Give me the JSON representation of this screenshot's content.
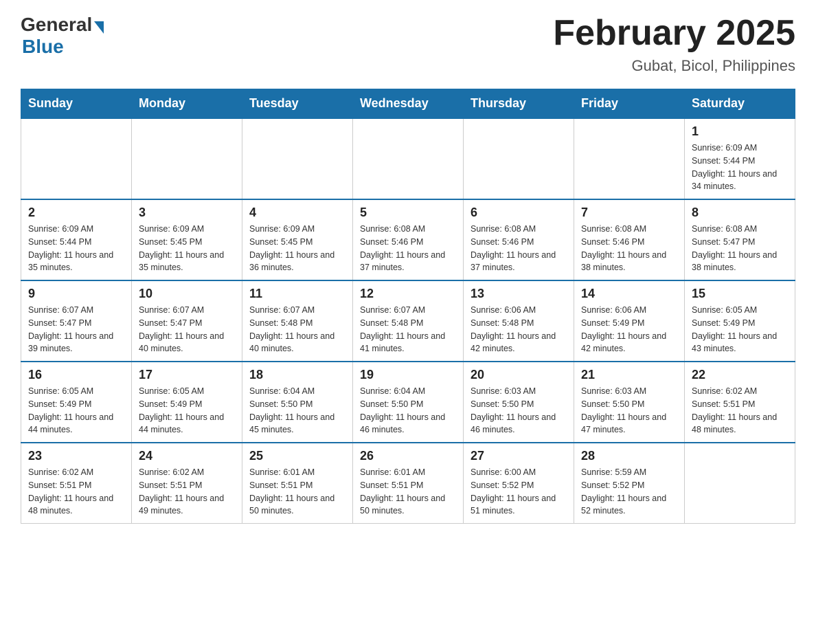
{
  "header": {
    "logo_general": "General",
    "logo_blue": "Blue",
    "main_title": "February 2025",
    "subtitle": "Gubat, Bicol, Philippines"
  },
  "days_of_week": [
    "Sunday",
    "Monday",
    "Tuesday",
    "Wednesday",
    "Thursday",
    "Friday",
    "Saturday"
  ],
  "weeks": [
    [
      {
        "day": "",
        "info": ""
      },
      {
        "day": "",
        "info": ""
      },
      {
        "day": "",
        "info": ""
      },
      {
        "day": "",
        "info": ""
      },
      {
        "day": "",
        "info": ""
      },
      {
        "day": "",
        "info": ""
      },
      {
        "day": "1",
        "info": "Sunrise: 6:09 AM\nSunset: 5:44 PM\nDaylight: 11 hours and 34 minutes."
      }
    ],
    [
      {
        "day": "2",
        "info": "Sunrise: 6:09 AM\nSunset: 5:44 PM\nDaylight: 11 hours and 35 minutes."
      },
      {
        "day": "3",
        "info": "Sunrise: 6:09 AM\nSunset: 5:45 PM\nDaylight: 11 hours and 35 minutes."
      },
      {
        "day": "4",
        "info": "Sunrise: 6:09 AM\nSunset: 5:45 PM\nDaylight: 11 hours and 36 minutes."
      },
      {
        "day": "5",
        "info": "Sunrise: 6:08 AM\nSunset: 5:46 PM\nDaylight: 11 hours and 37 minutes."
      },
      {
        "day": "6",
        "info": "Sunrise: 6:08 AM\nSunset: 5:46 PM\nDaylight: 11 hours and 37 minutes."
      },
      {
        "day": "7",
        "info": "Sunrise: 6:08 AM\nSunset: 5:46 PM\nDaylight: 11 hours and 38 minutes."
      },
      {
        "day": "8",
        "info": "Sunrise: 6:08 AM\nSunset: 5:47 PM\nDaylight: 11 hours and 38 minutes."
      }
    ],
    [
      {
        "day": "9",
        "info": "Sunrise: 6:07 AM\nSunset: 5:47 PM\nDaylight: 11 hours and 39 minutes."
      },
      {
        "day": "10",
        "info": "Sunrise: 6:07 AM\nSunset: 5:47 PM\nDaylight: 11 hours and 40 minutes."
      },
      {
        "day": "11",
        "info": "Sunrise: 6:07 AM\nSunset: 5:48 PM\nDaylight: 11 hours and 40 minutes."
      },
      {
        "day": "12",
        "info": "Sunrise: 6:07 AM\nSunset: 5:48 PM\nDaylight: 11 hours and 41 minutes."
      },
      {
        "day": "13",
        "info": "Sunrise: 6:06 AM\nSunset: 5:48 PM\nDaylight: 11 hours and 42 minutes."
      },
      {
        "day": "14",
        "info": "Sunrise: 6:06 AM\nSunset: 5:49 PM\nDaylight: 11 hours and 42 minutes."
      },
      {
        "day": "15",
        "info": "Sunrise: 6:05 AM\nSunset: 5:49 PM\nDaylight: 11 hours and 43 minutes."
      }
    ],
    [
      {
        "day": "16",
        "info": "Sunrise: 6:05 AM\nSunset: 5:49 PM\nDaylight: 11 hours and 44 minutes."
      },
      {
        "day": "17",
        "info": "Sunrise: 6:05 AM\nSunset: 5:49 PM\nDaylight: 11 hours and 44 minutes."
      },
      {
        "day": "18",
        "info": "Sunrise: 6:04 AM\nSunset: 5:50 PM\nDaylight: 11 hours and 45 minutes."
      },
      {
        "day": "19",
        "info": "Sunrise: 6:04 AM\nSunset: 5:50 PM\nDaylight: 11 hours and 46 minutes."
      },
      {
        "day": "20",
        "info": "Sunrise: 6:03 AM\nSunset: 5:50 PM\nDaylight: 11 hours and 46 minutes."
      },
      {
        "day": "21",
        "info": "Sunrise: 6:03 AM\nSunset: 5:50 PM\nDaylight: 11 hours and 47 minutes."
      },
      {
        "day": "22",
        "info": "Sunrise: 6:02 AM\nSunset: 5:51 PM\nDaylight: 11 hours and 48 minutes."
      }
    ],
    [
      {
        "day": "23",
        "info": "Sunrise: 6:02 AM\nSunset: 5:51 PM\nDaylight: 11 hours and 48 minutes."
      },
      {
        "day": "24",
        "info": "Sunrise: 6:02 AM\nSunset: 5:51 PM\nDaylight: 11 hours and 49 minutes."
      },
      {
        "day": "25",
        "info": "Sunrise: 6:01 AM\nSunset: 5:51 PM\nDaylight: 11 hours and 50 minutes."
      },
      {
        "day": "26",
        "info": "Sunrise: 6:01 AM\nSunset: 5:51 PM\nDaylight: 11 hours and 50 minutes."
      },
      {
        "day": "27",
        "info": "Sunrise: 6:00 AM\nSunset: 5:52 PM\nDaylight: 11 hours and 51 minutes."
      },
      {
        "day": "28",
        "info": "Sunrise: 5:59 AM\nSunset: 5:52 PM\nDaylight: 11 hours and 52 minutes."
      },
      {
        "day": "",
        "info": ""
      }
    ]
  ]
}
